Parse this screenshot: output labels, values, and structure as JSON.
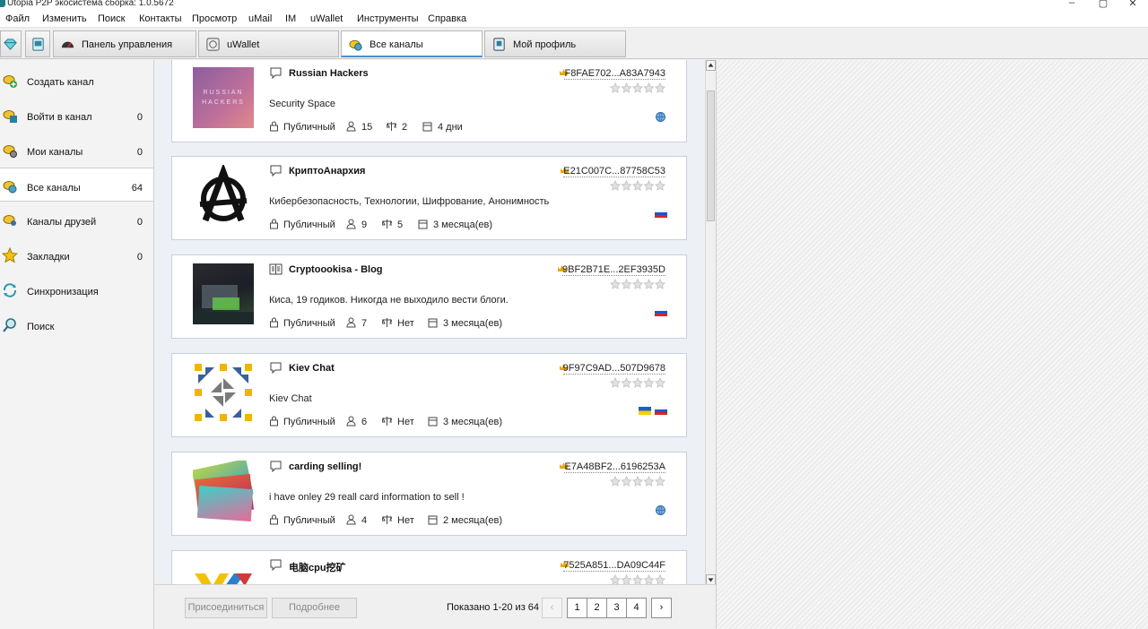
{
  "window": {
    "title": "Utopia P2P экосистема сборка: 1.0.5672"
  },
  "menu": [
    "Файл",
    "Изменить",
    "Поиск",
    "Контакты",
    "Просмотр",
    "uMail",
    "IM",
    "uWallet",
    "Инструменты",
    "Справка"
  ],
  "tabs": [
    {
      "label": "Панель управления",
      "icon": "gauge-icon"
    },
    {
      "label": "uWallet",
      "icon": "wallet-icon"
    },
    {
      "label": "Все каналы",
      "icon": "channels-icon",
      "active": true
    },
    {
      "label": "Мой профиль",
      "icon": "profile-icon"
    }
  ],
  "sidebar": [
    {
      "label": "Создать канал",
      "count": "",
      "icon": "create-channel-icon"
    },
    {
      "label": "Войти в канал",
      "count": "0",
      "icon": "enter-channel-icon"
    },
    {
      "label": "Мои каналы",
      "count": "0",
      "icon": "my-channels-icon"
    },
    {
      "label": "Все каналы",
      "count": "64",
      "icon": "all-channels-icon",
      "active": true
    },
    {
      "label": "Каналы друзей",
      "count": "0",
      "icon": "friends-channels-icon"
    },
    {
      "label": "Закладки",
      "count": "0",
      "icon": "star-icon"
    },
    {
      "label": "Синхронизация",
      "count": "",
      "icon": "sync-icon"
    },
    {
      "label": "Поиск",
      "count": "",
      "icon": "search-icon"
    }
  ],
  "channels": [
    {
      "name": "Russian Hackers",
      "thumb_text": "RUSSIAN HACKERS",
      "description": "Security Space",
      "access": "Публичный",
      "users": "15",
      "moderators": "2",
      "age": "4 дни",
      "owner": "F8FAE702...A83A7943",
      "kind": "chat",
      "lang": [
        "globe"
      ]
    },
    {
      "name": "КриптоАнархия",
      "description": "Кибербезопасность, Технологии, Шифрование, Анонимность",
      "access": "Публичный",
      "users": "9",
      "moderators": "5",
      "age": "3 месяца(ев)",
      "owner": "E21C007C...87758C53",
      "kind": "chat",
      "lang": [
        "ru"
      ]
    },
    {
      "name": "Cryptoookisa - Blog",
      "description": "Киса, 19 годиков. Никогда не выходило вести блоги.",
      "access": "Публичный",
      "users": "7",
      "moderators": "Нет",
      "age": "3 месяца(ев)",
      "owner": "9BF2B71E...2EF3935D",
      "kind": "blog",
      "lang": [
        "ru"
      ]
    },
    {
      "name": "Kiev Chat",
      "description": "Kiev Chat",
      "access": "Публичный",
      "users": "6",
      "moderators": "Нет",
      "age": "3 месяца(ев)",
      "owner": "9F97C9AD...507D9678",
      "kind": "chat",
      "lang": [
        "ua",
        "ru"
      ]
    },
    {
      "name": "carding selling!",
      "description": "i have onley 29 reall card information to sell !",
      "access": "Публичный",
      "users": "4",
      "moderators": "Нет",
      "age": "2 месяца(ев)",
      "owner": "E7A48BF2...6196253A",
      "kind": "chat",
      "lang": [
        "globe"
      ]
    },
    {
      "name": "电脑cpu挖矿",
      "description": "",
      "access": "",
      "users": "",
      "moderators": "",
      "age": "",
      "owner": "7525A851...DA09C44F",
      "kind": "chat",
      "lang": []
    }
  ],
  "footer": {
    "join_label": "Присоединиться",
    "details_label": "Подробнее",
    "shown_text": "Показано 1-20 из 64",
    "pages": [
      "1",
      "2",
      "3",
      "4"
    ],
    "prev": "‹",
    "next": "›"
  }
}
